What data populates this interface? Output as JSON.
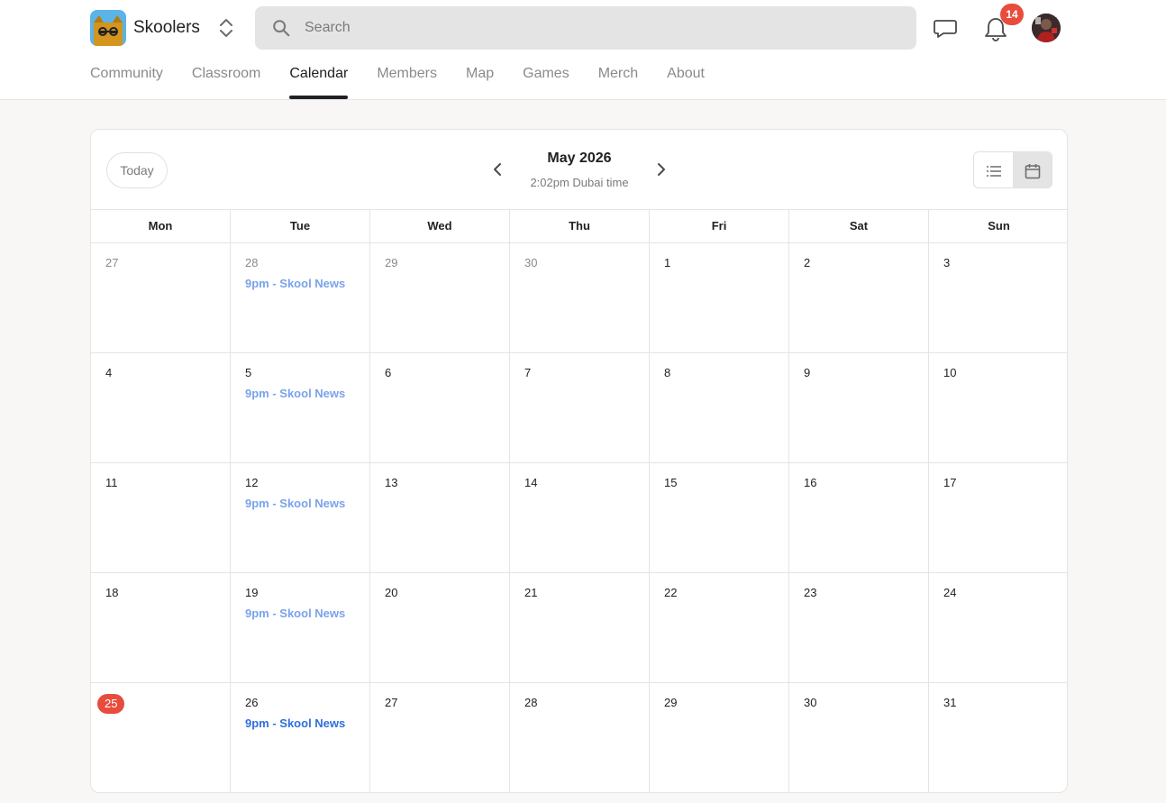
{
  "app": {
    "brand": "Skoolers",
    "search_placeholder": "Search",
    "notification_count": "14"
  },
  "nav": {
    "items": [
      {
        "label": "Community",
        "active": false
      },
      {
        "label": "Classroom",
        "active": false
      },
      {
        "label": "Calendar",
        "active": true
      },
      {
        "label": "Members",
        "active": false
      },
      {
        "label": "Map",
        "active": false
      },
      {
        "label": "Games",
        "active": false
      },
      {
        "label": "Merch",
        "active": false
      },
      {
        "label": "About",
        "active": false
      }
    ]
  },
  "calendar": {
    "today_label": "Today",
    "month_title": "May 2026",
    "timezone_text": "2:02pm Dubai time",
    "view_modes": [
      "list-icon",
      "calendar-icon"
    ],
    "active_view": "calendar",
    "weekdays": [
      "Mon",
      "Tue",
      "Wed",
      "Thu",
      "Fri",
      "Sat",
      "Sun"
    ],
    "weeks": [
      [
        {
          "num": "27",
          "muted": true
        },
        {
          "num": "28",
          "muted": true,
          "event": "9pm - Skool News",
          "event_past": true
        },
        {
          "num": "29",
          "muted": true
        },
        {
          "num": "30",
          "muted": true
        },
        {
          "num": "1"
        },
        {
          "num": "2"
        },
        {
          "num": "3"
        }
      ],
      [
        {
          "num": "4"
        },
        {
          "num": "5",
          "event": "9pm - Skool News",
          "event_past": true
        },
        {
          "num": "6"
        },
        {
          "num": "7"
        },
        {
          "num": "8"
        },
        {
          "num": "9"
        },
        {
          "num": "10"
        }
      ],
      [
        {
          "num": "11"
        },
        {
          "num": "12",
          "event": "9pm - Skool News",
          "event_past": true
        },
        {
          "num": "13"
        },
        {
          "num": "14"
        },
        {
          "num": "15"
        },
        {
          "num": "16"
        },
        {
          "num": "17"
        }
      ],
      [
        {
          "num": "18"
        },
        {
          "num": "19",
          "event": "9pm - Skool News",
          "event_past": true
        },
        {
          "num": "20"
        },
        {
          "num": "21"
        },
        {
          "num": "22"
        },
        {
          "num": "23"
        },
        {
          "num": "24"
        }
      ],
      [
        {
          "num": "25",
          "today": true
        },
        {
          "num": "26",
          "event": "9pm - Skool News",
          "event_past": false
        },
        {
          "num": "27"
        },
        {
          "num": "28"
        },
        {
          "num": "29"
        },
        {
          "num": "30"
        },
        {
          "num": "31"
        }
      ]
    ]
  },
  "colors": {
    "accent_red": "#e74c3c",
    "event_past": "#7aa3ea",
    "event_upcoming": "#2f6fdc",
    "logo_bg": "#5ab4e8",
    "logo_cat": "#d4951e"
  }
}
